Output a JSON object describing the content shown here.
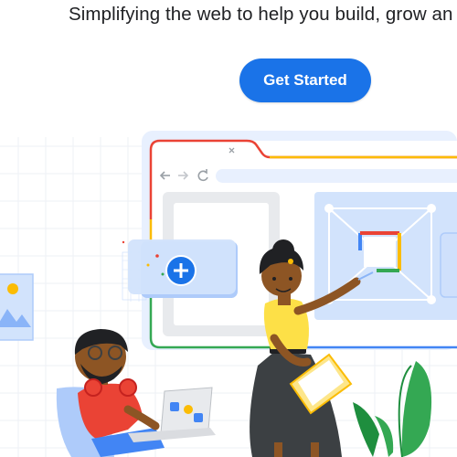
{
  "hero": {
    "tagline": "Simplifying the web to help you build, grow an",
    "cta_label": "Get Started"
  },
  "colors": {
    "cta_bg": "#1a73e8",
    "text": "#202124",
    "google_red": "#ea4335",
    "google_yellow": "#fbbc04",
    "google_green": "#34a853",
    "google_blue": "#4285f4"
  },
  "icons": [
    "back-arrow-icon",
    "forward-arrow-icon",
    "reload-icon",
    "close-icon",
    "plus-icon",
    "image-icon",
    "google-web-logo-icon"
  ]
}
